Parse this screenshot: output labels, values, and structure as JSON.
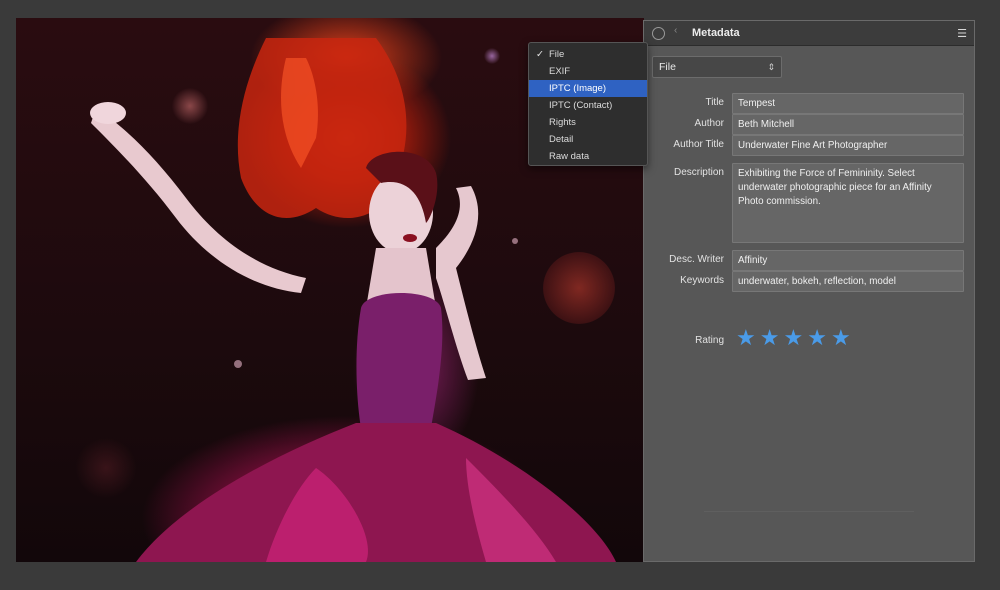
{
  "panel": {
    "title": "Metadata",
    "menu_icon": "hamburger-menu-icon",
    "schema_selected": "File"
  },
  "dropdown": {
    "items": [
      {
        "label": "File",
        "checked": true,
        "selected": false
      },
      {
        "label": "EXIF",
        "checked": false,
        "selected": false
      },
      {
        "label": "IPTC (Image)",
        "checked": false,
        "selected": true
      },
      {
        "label": "IPTC (Contact)",
        "checked": false,
        "selected": false
      },
      {
        "label": "Rights",
        "checked": false,
        "selected": false
      },
      {
        "label": "Detail",
        "checked": false,
        "selected": false
      },
      {
        "label": "Raw data",
        "checked": false,
        "selected": false
      }
    ],
    "check_glyph": "✓"
  },
  "fields": {
    "title": {
      "label": "Title",
      "value": "Tempest"
    },
    "author": {
      "label": "Author",
      "value": "Beth Mitchell"
    },
    "author_title": {
      "label": "Author Title",
      "value": "Underwater Fine Art Photographer"
    },
    "description": {
      "label": "Description",
      "value": "Exhibiting the Force of Femininity. Select underwater photographic piece for an Affinity Photo commission."
    },
    "desc_writer": {
      "label": "Desc. Writer",
      "value": "Affinity"
    },
    "keywords": {
      "label": "Keywords",
      "value": "underwater, bokeh, reflection, model"
    }
  },
  "rating": {
    "label": "Rating",
    "value": 5,
    "max": 5,
    "color": "#4a9be8"
  },
  "colors": {
    "selection": "#2f62c2",
    "panel_bg": "#575757",
    "header_bg": "#3c3c3c"
  }
}
